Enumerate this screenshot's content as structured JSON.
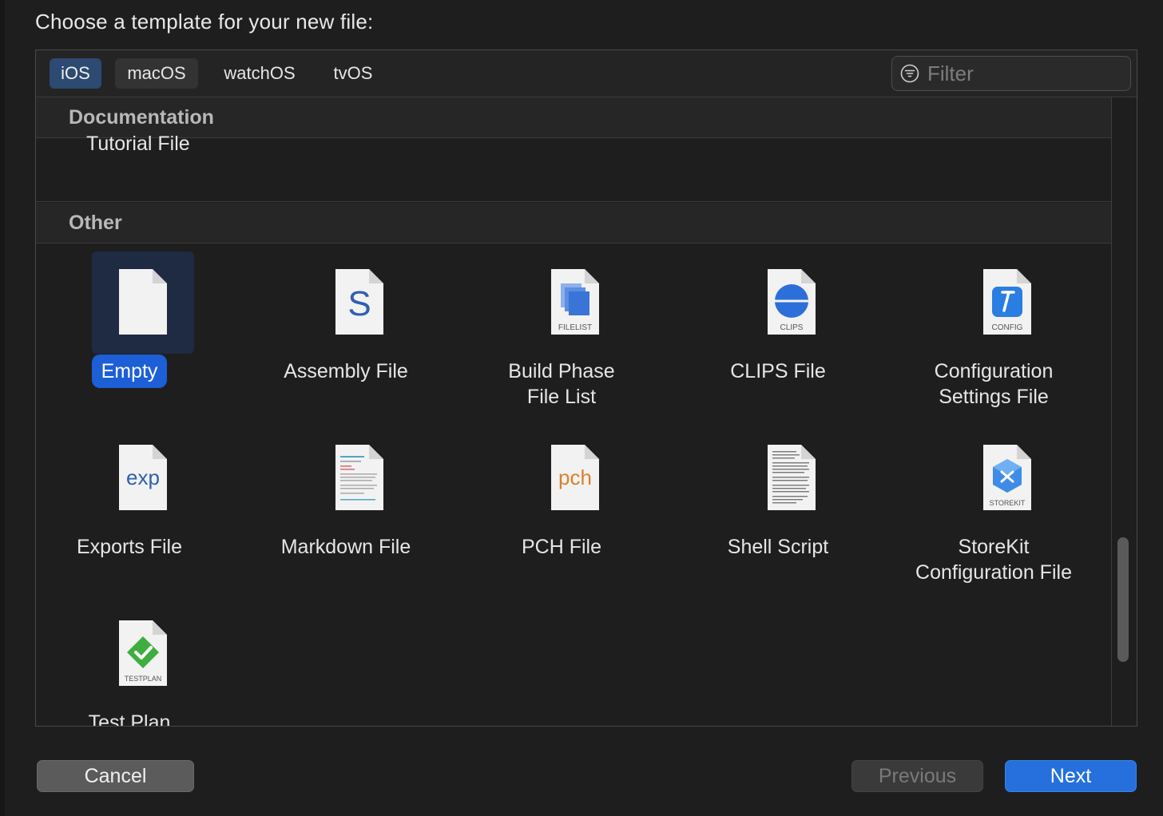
{
  "header": {
    "title": "Choose a template for your new file:"
  },
  "tabs": [
    {
      "label": "iOS",
      "selected": true
    },
    {
      "label": "macOS",
      "selected": false
    },
    {
      "label": "watchOS",
      "selected": false
    },
    {
      "label": "tvOS",
      "selected": false
    }
  ],
  "filter": {
    "placeholder": "Filter",
    "value": ""
  },
  "sections": {
    "documentation": {
      "title": "Documentation",
      "items": [
        "Tutorial File"
      ]
    },
    "other": {
      "title": "Other",
      "items": [
        {
          "label": "Empty",
          "icon": "empty-doc-icon",
          "selected": true
        },
        {
          "label": "Assembly File",
          "icon": "assembly-s-icon",
          "badge": "S"
        },
        {
          "label": "Build Phase\nFile List",
          "line1": "Build Phase",
          "line2": "File List",
          "icon": "filelist-icon",
          "badge": "FILELIST"
        },
        {
          "label": "CLIPS File",
          "icon": "clips-icon",
          "badge": "CLIPS"
        },
        {
          "label": "Configuration Settings File",
          "line1": "Configuration",
          "line2": "Settings File",
          "icon": "config-icon",
          "badge": "CONFIG"
        },
        {
          "label": "Exports File",
          "icon": "exp-icon",
          "badge": "exp"
        },
        {
          "label": "Markdown File",
          "icon": "markdown-doc-icon"
        },
        {
          "label": "PCH File",
          "icon": "pch-icon",
          "badge": "pch"
        },
        {
          "label": "Shell Script",
          "icon": "shell-script-doc-icon"
        },
        {
          "label": "StoreKit Configuration File",
          "line1": "StoreKit",
          "line2": "Configuration File",
          "icon": "storekit-icon",
          "badge": "STOREKIT"
        },
        {
          "label": "Test Plan",
          "icon": "testplan-icon",
          "badge": "TESTPLAN"
        }
      ]
    }
  },
  "buttons": {
    "cancel": "Cancel",
    "previous": "Previous",
    "next": "Next"
  },
  "colors": {
    "accent": "#2570dc",
    "selectedTab": "#2c4a72",
    "background": "#1e1e1e"
  }
}
